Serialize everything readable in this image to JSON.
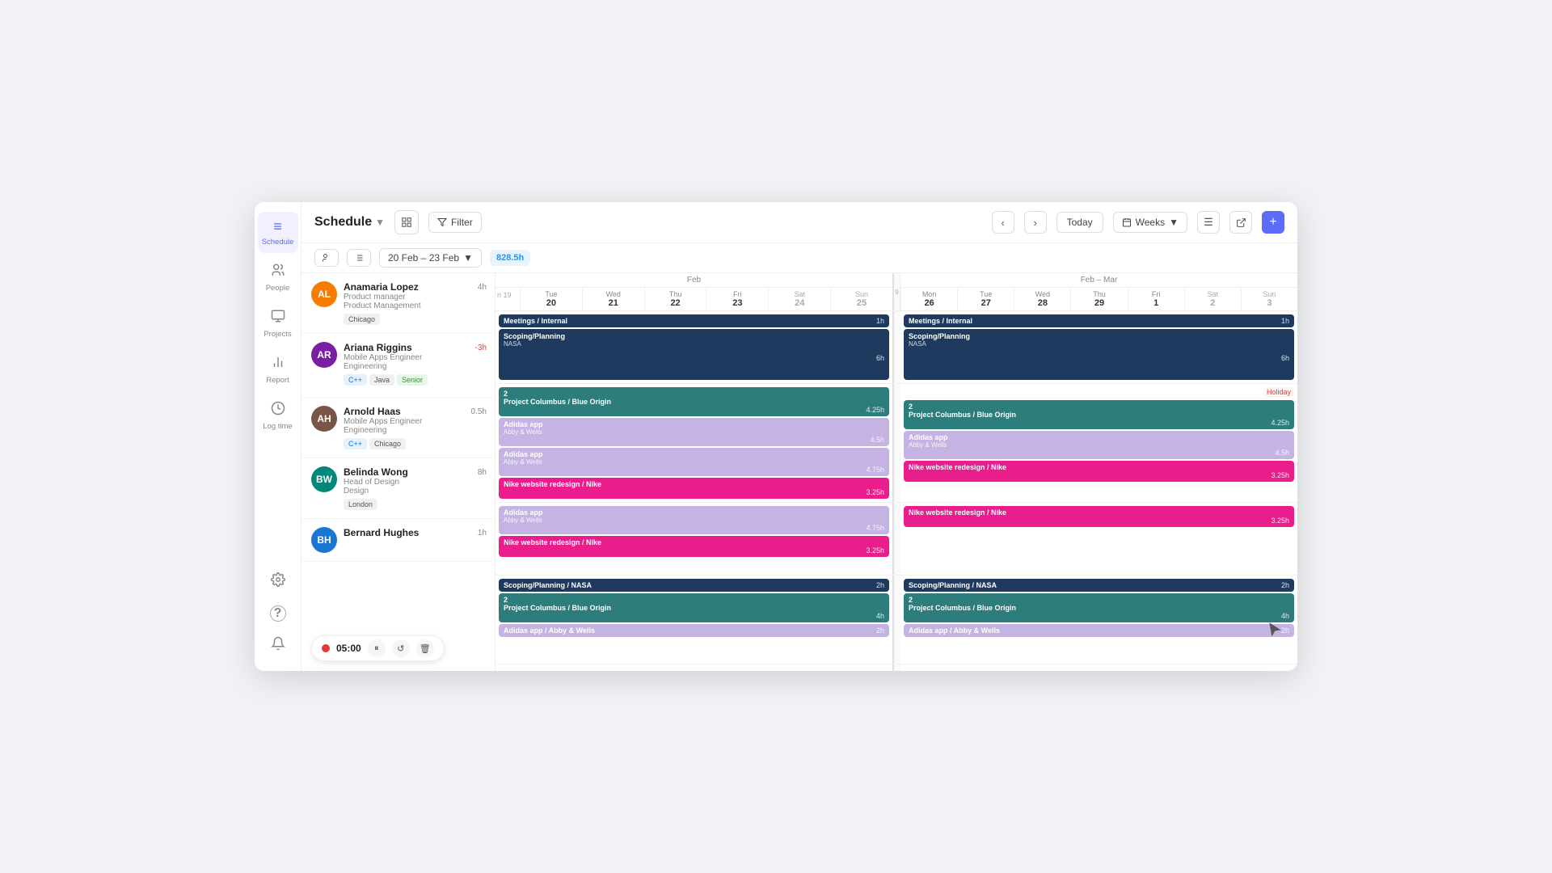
{
  "app": {
    "title": "Schedule",
    "filter_label": "Filter",
    "today_label": "Today",
    "weeks_label": "Weeks",
    "add_icon": "+",
    "date_range": "20 Feb – 23 Feb",
    "hours_total": "828.5h"
  },
  "sidebar": {
    "items": [
      {
        "id": "schedule",
        "label": "Schedule",
        "icon": "≡",
        "active": true
      },
      {
        "id": "people",
        "label": "People",
        "icon": "👤",
        "active": false
      },
      {
        "id": "projects",
        "label": "Projects",
        "icon": "📁",
        "active": false
      },
      {
        "id": "report",
        "label": "Report",
        "icon": "📊",
        "active": false
      },
      {
        "id": "logtime",
        "label": "Log time",
        "icon": "⏱",
        "active": false
      }
    ],
    "bottom_items": [
      {
        "id": "settings",
        "icon": "⚙",
        "label": ""
      },
      {
        "id": "help",
        "icon": "?",
        "label": ""
      },
      {
        "id": "notifications",
        "icon": "🔔",
        "label": ""
      }
    ]
  },
  "calendar": {
    "week1_label": "Feb",
    "week2_label": "Feb – Mar",
    "days_week1": [
      {
        "name": "n 19",
        "num": ""
      },
      {
        "name": "Tue 20",
        "num": "20"
      },
      {
        "name": "Wed 21",
        "num": "21"
      },
      {
        "name": "Thu 22",
        "num": "22"
      },
      {
        "name": "Fri 23",
        "num": "23"
      },
      {
        "name": "Sat 24",
        "num": "24"
      },
      {
        "name": "Sun 25",
        "num": "25"
      }
    ],
    "days_week2": [
      {
        "name": "Mon 26",
        "num": "26"
      },
      {
        "name": "Tue 27",
        "num": "27"
      },
      {
        "name": "Wed 28",
        "num": "28"
      },
      {
        "name": "Thu 29",
        "num": "29"
      },
      {
        "name": "Fri 1",
        "num": "1"
      },
      {
        "name": "Sat 2",
        "num": "2"
      },
      {
        "name": "Sun 3",
        "num": "3"
      }
    ]
  },
  "people": [
    {
      "name": "Anamaria Lopez",
      "role": "Product manager",
      "dept": "Product Management",
      "location": "Chicago",
      "hours": "4h",
      "hours_negative": false,
      "avatar_initials": "AL",
      "avatar_class": "av-orange",
      "events_w1": [
        {
          "type": "meetings",
          "title": "Meetings / Internal",
          "sub": "",
          "hours": "1h",
          "color": "dark-blue",
          "span": 5
        },
        {
          "type": "scoping",
          "title": "Scoping/Planning",
          "sub": "NASA",
          "hours": "6h",
          "color": "dark-blue",
          "span": 5
        }
      ],
      "events_w2": [
        {
          "type": "meetings",
          "title": "Meetings / Internal",
          "sub": "",
          "hours": "1h",
          "color": "dark-blue",
          "span": 5
        },
        {
          "type": "scoping",
          "title": "Scoping/Planning",
          "sub": "NASA",
          "hours": "6h",
          "color": "dark-blue",
          "span": 5
        }
      ]
    },
    {
      "name": "Ariana Riggins",
      "role": "Mobile Apps Engineer",
      "dept": "Engineering",
      "tags": [
        "C++",
        "Java",
        "Senior"
      ],
      "tag_classes": [
        "blue",
        "",
        "green"
      ],
      "hours": "-3h",
      "hours_negative": true,
      "avatar_initials": "AR",
      "avatar_class": "av-purple",
      "events_w1": [
        {
          "title": "Project Columbus / Blue Origin",
          "sub": "",
          "hours": "4.25h",
          "color": "teal"
        },
        {
          "title": "Adidas app",
          "sub": "Abby & Wells",
          "hours": "4.5h",
          "color": "lavender"
        },
        {
          "title": "Adidas app",
          "sub": "Abby & Wells",
          "hours": "4.75h",
          "color": "lavender"
        },
        {
          "title": "Nike website redesign / Nike",
          "sub": "",
          "hours": "3.25h",
          "color": "pink"
        }
      ],
      "events_w2": [
        {
          "title": "Project Columbus / Blue Origin",
          "sub": "",
          "hours": "4.25h",
          "color": "teal"
        },
        {
          "title": "Adidas app",
          "sub": "Abby & Wells",
          "hours": "4.5h",
          "color": "lavender"
        },
        {
          "title": "Nike website redesign / Nike",
          "sub": "",
          "hours": "3.25h",
          "color": "pink"
        }
      ],
      "holiday_w2": "Holiday"
    },
    {
      "name": "Arnold Haas",
      "role": "Mobile Apps Engineer",
      "dept": "Engineering",
      "tags": [
        "C++",
        "Chicago"
      ],
      "tag_classes": [
        "blue",
        ""
      ],
      "hours": "0.5h",
      "hours_negative": false,
      "avatar_initials": "AH",
      "avatar_class": "av-brown",
      "events_w1": [
        {
          "title": "Adidas app",
          "sub": "Abby & Wells",
          "hours": "4.75h",
          "color": "lavender"
        },
        {
          "title": "Nike website redesign / Nike",
          "sub": "",
          "hours": "3.25h",
          "color": "pink"
        }
      ],
      "events_w2": [
        {
          "title": "Nike website redesign / Nike",
          "sub": "",
          "hours": "3.25h",
          "color": "pink"
        }
      ]
    },
    {
      "name": "Belinda Wong",
      "role": "Head of Design",
      "dept": "Design",
      "location": "London",
      "hours": "8h",
      "hours_negative": false,
      "avatar_initials": "BW",
      "avatar_class": "av-teal",
      "events_w1": [
        {
          "title": "Scoping/Planning / NASA",
          "sub": "",
          "hours": "2h",
          "color": "dark-blue"
        },
        {
          "title": "Project Columbus / Blue Origin",
          "sub": "",
          "hours": "4h",
          "color": "teal"
        },
        {
          "title": "Adidas app / Abby & Wells",
          "sub": "",
          "hours": "2h",
          "color": "lavender"
        }
      ],
      "events_w2": [
        {
          "title": "Scoping/Planning / NASA",
          "sub": "",
          "hours": "2h",
          "color": "dark-blue"
        },
        {
          "title": "Project Columbus / Blue Origin",
          "sub": "",
          "hours": "4h",
          "color": "teal"
        },
        {
          "title": "Adidas app / Abby & Wells",
          "sub": "",
          "hours": "2h",
          "color": "lavender"
        }
      ]
    },
    {
      "name": "Bernard Hughes",
      "role": "",
      "dept": "",
      "tags": [],
      "hours": "1h",
      "hours_negative": false,
      "avatar_initials": "BH",
      "avatar_class": "av-blue"
    }
  ],
  "timer": {
    "time": "05:00",
    "recording": true
  },
  "colors": {
    "accent": "#5b6cf8",
    "dark_blue_event": "#1e3a5f",
    "teal_event": "#2d7d7d",
    "lavender_event": "#b39ddb",
    "pink_event": "#e91e8c"
  }
}
